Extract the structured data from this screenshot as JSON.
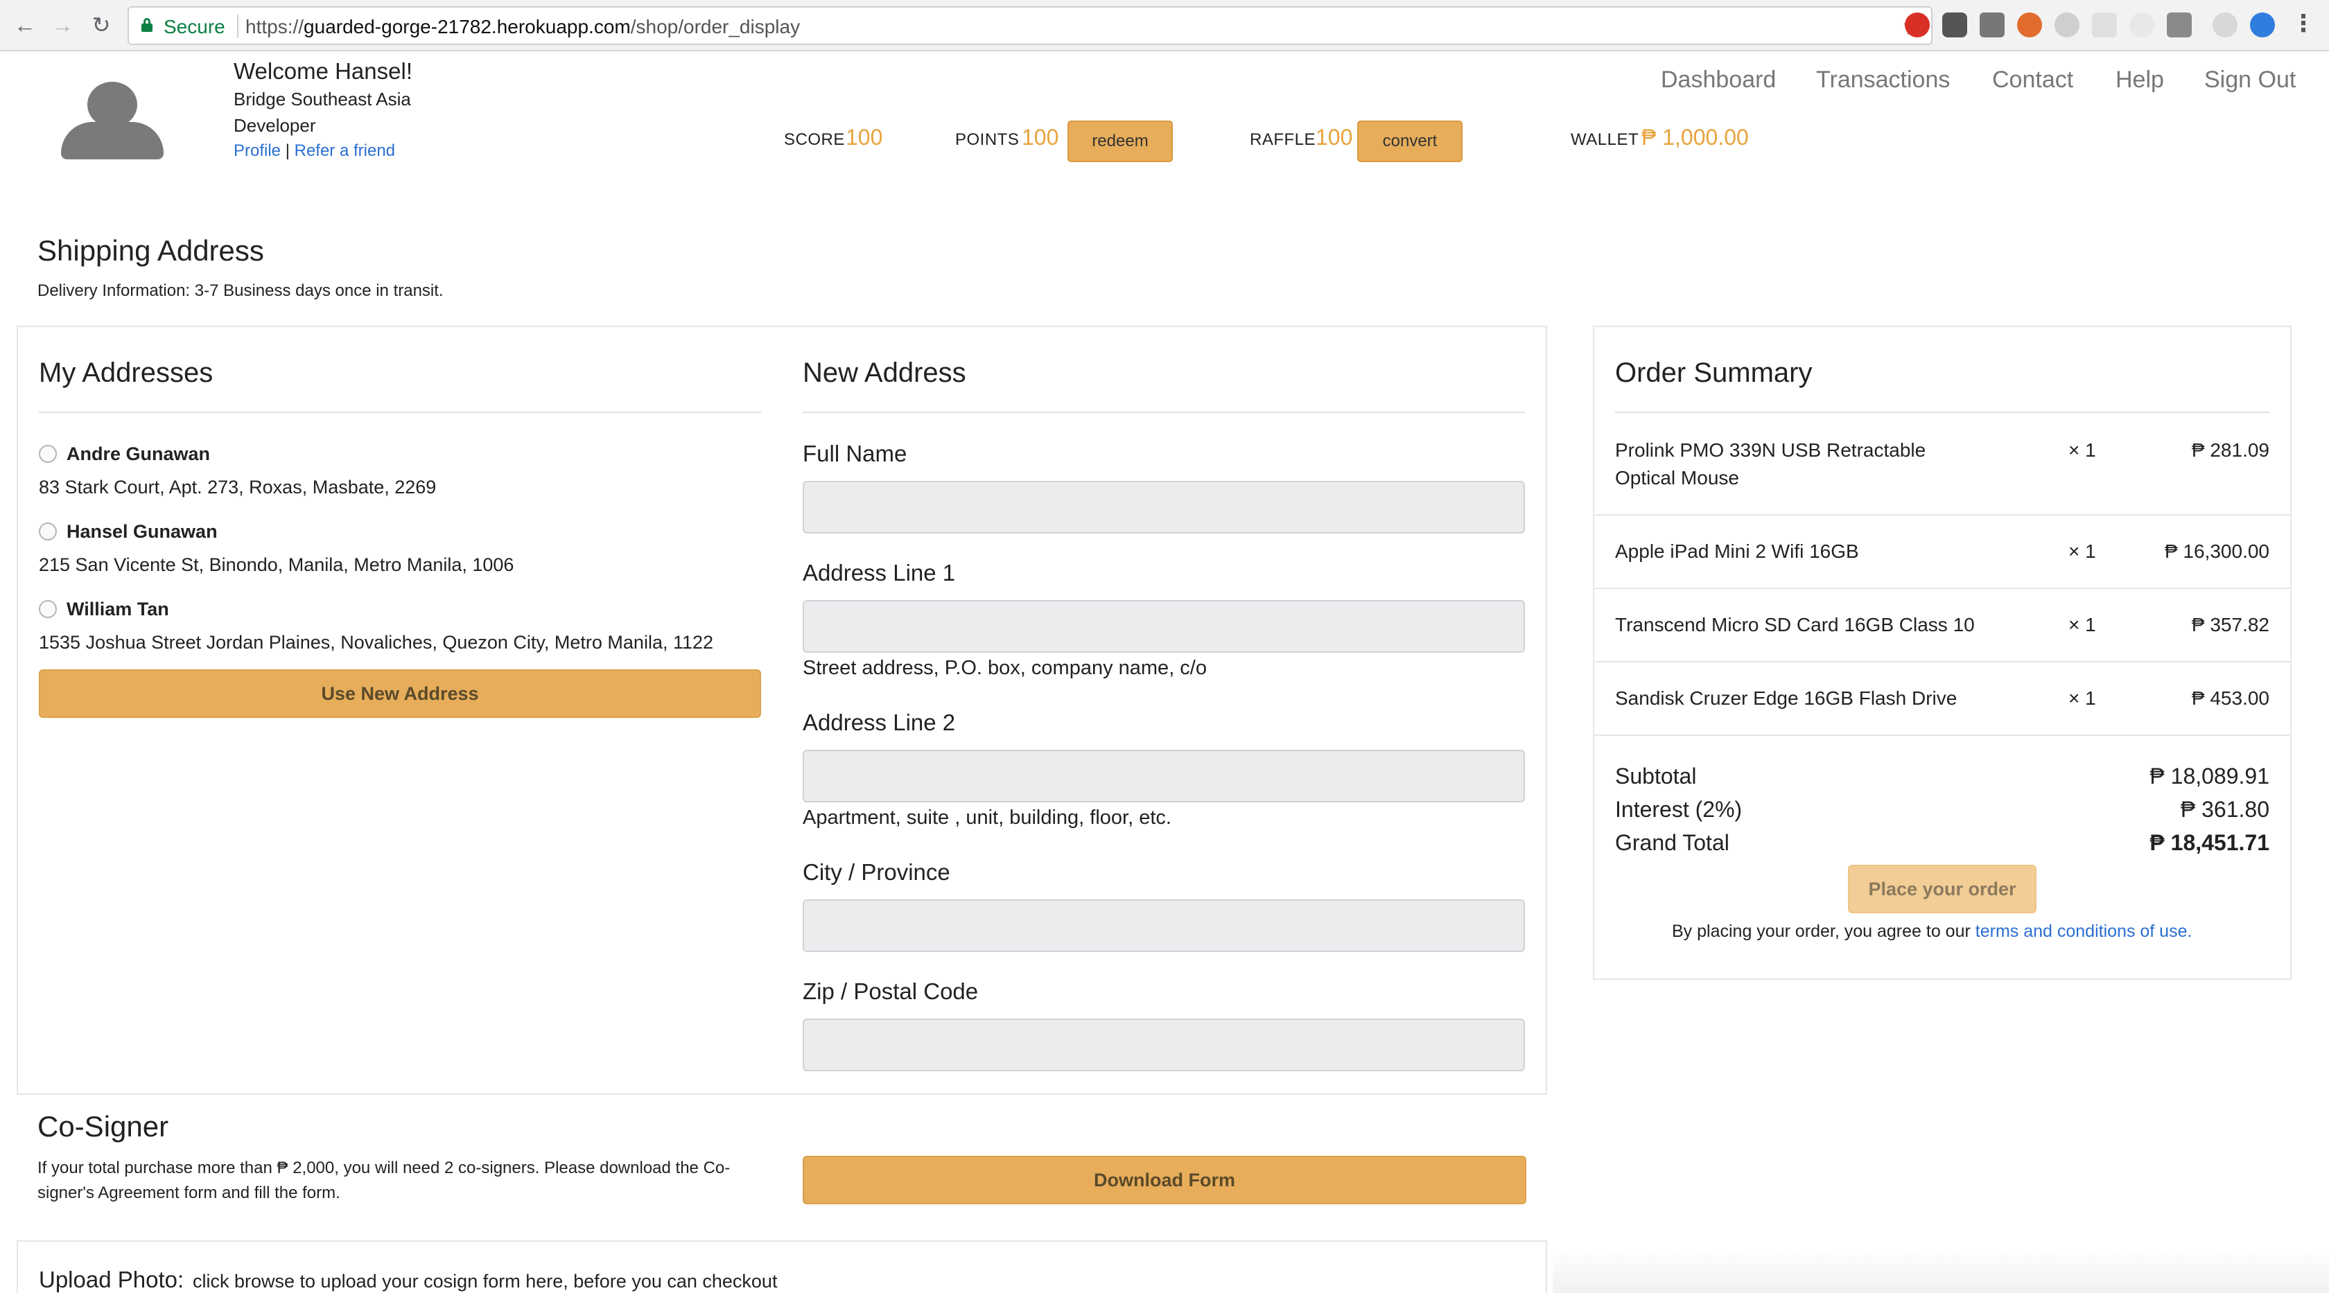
{
  "browser": {
    "secure_label": "Secure",
    "url_scheme": "https://",
    "url_host": "guarded-gorge-21782.herokuapp.com",
    "url_path": "/shop/order_display"
  },
  "header": {
    "welcome": "Welcome Hansel!",
    "company": "Bridge Southeast Asia",
    "role": "Developer",
    "profile_link": "Profile",
    "separator": "|",
    "refer_link": "Refer a friend",
    "stats": {
      "score_label": "SCORE",
      "score_value": "100",
      "points_label": "POINTS",
      "points_value": "100",
      "redeem_label": "redeem",
      "raffle_label": "RAFFLE",
      "raffle_value": "100",
      "convert_label": "convert",
      "wallet_label": "WALLET",
      "wallet_value": "₱ 1,000.00"
    },
    "nav": [
      "Dashboard",
      "Transactions",
      "Contact",
      "Help",
      "Sign Out"
    ]
  },
  "shipping": {
    "title": "Shipping Address",
    "delivery_info": "Delivery Information: 3-7 Business days once in transit."
  },
  "my_addresses": {
    "title": "My Addresses",
    "items": [
      {
        "name": "Andre Gunawan",
        "address": "83 Stark Court, Apt. 273, Roxas, Masbate, 2269"
      },
      {
        "name": "Hansel Gunawan",
        "address": "215 San Vicente St, Binondo, Manila, Metro Manila, 1006"
      },
      {
        "name": "William Tan",
        "address": "1535 Joshua Street Jordan Plaines, Novaliches, Quezon City, Metro Manila, 1122"
      }
    ],
    "use_new_label": "Use New Address"
  },
  "new_address": {
    "title": "New Address",
    "full_name_label": "Full Name",
    "line1_label": "Address Line 1",
    "line1_help": "Street address, P.O. box, company name, c/o",
    "line2_label": "Address Line 2",
    "line2_help": "Apartment, suite , unit, building, floor, etc.",
    "city_label": "City / Province",
    "zip_label": "Zip / Postal Code"
  },
  "order_summary": {
    "title": "Order Summary",
    "items": [
      {
        "name_line1": "Prolink PMO 339N USB Retractable",
        "name_line2": "Optical Mouse",
        "qty": "× 1",
        "price": "₱ 281.09"
      },
      {
        "name_line1": "Apple iPad Mini 2 Wifi 16GB",
        "name_line2": "",
        "qty": "× 1",
        "price": "₱ 16,300.00"
      },
      {
        "name_line1": "Transcend Micro SD Card 16GB Class 10",
        "name_line2": "",
        "qty": "× 1",
        "price": "₱ 357.82"
      },
      {
        "name_line1": "Sandisk Cruzer Edge 16GB Flash Drive",
        "name_line2": "",
        "qty": "× 1",
        "price": "₱ 453.00"
      }
    ],
    "subtotal_label": "Subtotal",
    "subtotal_value": "₱ 18,089.91",
    "interest_label": "Interest (2%)",
    "interest_value": "₱ 361.80",
    "grand_total_label": "Grand Total",
    "grand_total_value": "₱ 18,451.71",
    "place_order_label": "Place your order",
    "agree_text": "By placing your order, you agree to our ",
    "terms_link": "terms and conditions of use."
  },
  "cosigner": {
    "title": "Co-Signer",
    "text_line1": "If your total purchase more than ₱ 2,000, you will need 2 co-signers. Please download the Co-",
    "text_line2": "signer's Agreement form and fill the form.",
    "download_label": "Download Form"
  },
  "upload": {
    "title": "Upload Photo:",
    "subtitle": "click browse to upload your cosign form here, before you can checkout"
  },
  "colors": {
    "accent_orange": "#e7ad5a",
    "stat_orange": "#e8a33c",
    "link_blue": "#2a6fd1",
    "secure_green": "#0b8043"
  }
}
